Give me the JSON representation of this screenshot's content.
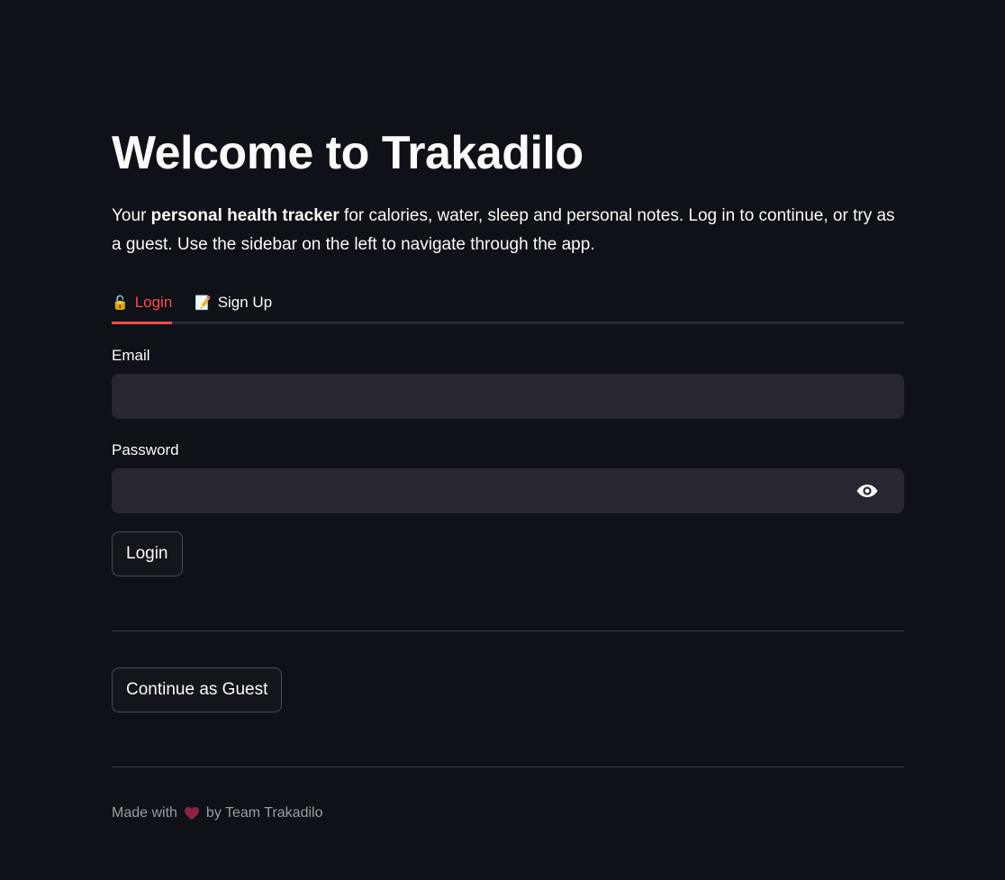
{
  "page": {
    "title": "Welcome to Trakadilo",
    "intro": {
      "prefix": "Your ",
      "bold": "personal health tracker",
      "suffix": " for calories, water, sleep and personal notes. Log in to continue, or try as a guest. Use the sidebar on the left to navigate through the app."
    }
  },
  "tabs": [
    {
      "icon": "🔓",
      "icon_name": "unlock-icon",
      "label": "Login",
      "active": true
    },
    {
      "icon": "📝",
      "icon_name": "memo-icon",
      "label": "Sign Up",
      "active": false
    }
  ],
  "login_form": {
    "email_label": "Email",
    "email_value": "",
    "email_placeholder": "",
    "password_label": "Password",
    "password_value": "",
    "password_placeholder": "",
    "password_toggle_icon": "eye-icon",
    "submit_label": "Login"
  },
  "guest": {
    "button_label": "Continue as Guest"
  },
  "footer": {
    "prefix": "Made with",
    "heart_icon": "heart-icon",
    "suffix": "by Team Trakadilo"
  },
  "colors": {
    "background": "#0e1117",
    "accent": "#ff4b4b",
    "input_background": "#262730",
    "text": "#fafafa",
    "muted_text": "#9a9ca3"
  }
}
